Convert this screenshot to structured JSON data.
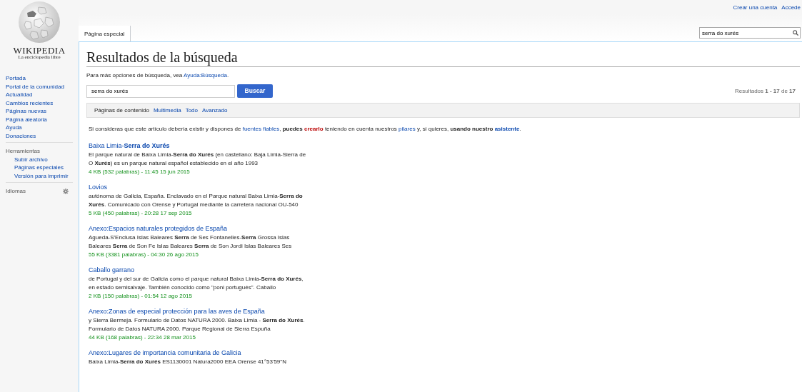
{
  "personal_links": [
    {
      "label": "Crear una cuenta"
    },
    {
      "label": "Accede"
    }
  ],
  "logo": {
    "wordmark": "WIKIPEDIA",
    "tagline": "La enciclopedia libre"
  },
  "sidebar": {
    "navigation": [
      {
        "label": "Portada"
      },
      {
        "label": "Portal de la comunidad"
      },
      {
        "label": "Actualidad"
      },
      {
        "label": "Cambios recientes"
      },
      {
        "label": "Páginas nuevas"
      },
      {
        "label": "Página aleatoria"
      },
      {
        "label": "Ayuda"
      },
      {
        "label": "Donaciones"
      }
    ],
    "tools_heading": "Herramientas",
    "tools": [
      {
        "label": "Subir archivo"
      },
      {
        "label": "Páginas especiales"
      },
      {
        "label": "Versión para imprimir"
      }
    ],
    "languages_heading": "Idiomas"
  },
  "tabs": [
    {
      "label": "Página especial",
      "selected": true
    }
  ],
  "header_search": {
    "value": "serra do xurés"
  },
  "title": "Resultados de la búsqueda",
  "help": {
    "text": "Para más opciones de búsqueda, vea ",
    "link": "Ayuda:Búsqueda",
    "end": "."
  },
  "search": {
    "value": "serra do xurés",
    "button": "Buscar"
  },
  "result_count": "Resultados **1 - 17** de **17**",
  "profiles": [
    {
      "label": "Páginas de contenido",
      "selected": true
    },
    {
      "label": "Multimedia",
      "selected": false
    },
    {
      "label": "Todo",
      "selected": false
    },
    {
      "label": "Avanzado",
      "selected": false
    }
  ],
  "notice": [
    {
      "kind": "text",
      "text": "Si consideras que este artículo debería existir y dispones de "
    },
    {
      "kind": "link",
      "text": "fuentes fiables"
    },
    {
      "kind": "text",
      "text": ", "
    },
    {
      "kind": "bold",
      "text": "puedes "
    },
    {
      "kind": "redlink",
      "text": "crearlo"
    },
    {
      "kind": "text",
      "text": " teniendo en cuenta nuestros "
    },
    {
      "kind": "link",
      "text": "pilares"
    },
    {
      "kind": "text",
      "text": " y, si quieres, "
    },
    {
      "kind": "bold",
      "text": "usando nuestro "
    },
    {
      "kind": "boldlink",
      "text": "asistente"
    },
    {
      "kind": "text",
      "text": "."
    }
  ],
  "results": [
    {
      "title": "Baixa Limia-**Serra do Xurés**",
      "snippet": [
        "El parque natural de Baixa Limia-**Serra do Xurés** (en castellano: Baja Limia-Sierra de",
        "O **Xurés**) es un parque natural español establecido en el año 1993"
      ],
      "meta": "4 KB (532 palabras) - 11:45 15 jun 2015"
    },
    {
      "title": "Lovios",
      "snippet": [
        "autónoma de Galicia, España. Enclavado en el Parque natural Baixa Limia-**Serra do**",
        "**Xurés**. Comunicado con Orense y Portugal mediante la carretera nacional OU-540"
      ],
      "meta": "5 KB (450 palabras) - 20:28 17 sep 2015"
    },
    {
      "title": "Anexo:Espacios naturales protegidos de España",
      "snippet": [
        "Agueda-S'Enclusa Islas Baleares **Serra** de Ses Fontanelles-**Serra** Grossa Islas",
        "Baleares **Serra** de Son Fe Islas Baleares **Serra** de Son Jordi Islas Baleares Ses"
      ],
      "meta": "55 KB (3381 palabras) - 04:30 26 ago 2015"
    },
    {
      "title": "Caballo garrano",
      "snippet": [
        "de Portugal y del sur de Galicia como el parque natural Baixa Limia-**Serra do Xurés**,",
        "en estado semisalvaje. También conocido como \"poni portugués\". Caballo"
      ],
      "meta": "2 KB (150 palabras) - 01:54 12 ago 2015"
    },
    {
      "title": "Anexo:Zonas de especial protección para las aves de España",
      "snippet": [
        "y Sierra Bermeja.  Formulario de Datos NATURA 2000. Baixa Limia - **Serra do Xurés**.",
        "Formulario de Datos NATURA 2000. Parque Regional de Sierra Espuña"
      ],
      "meta": "44 KB (168 palabras) - 22:34 28 mar 2015"
    },
    {
      "title": "Anexo:Lugares de importancia comunitaria de Galicia",
      "snippet": [
        "Baixa Limia-**Serra do Xurés** ES1130001 Natura2000 EEA Orense 41°53'59\"N"
      ]
    }
  ]
}
